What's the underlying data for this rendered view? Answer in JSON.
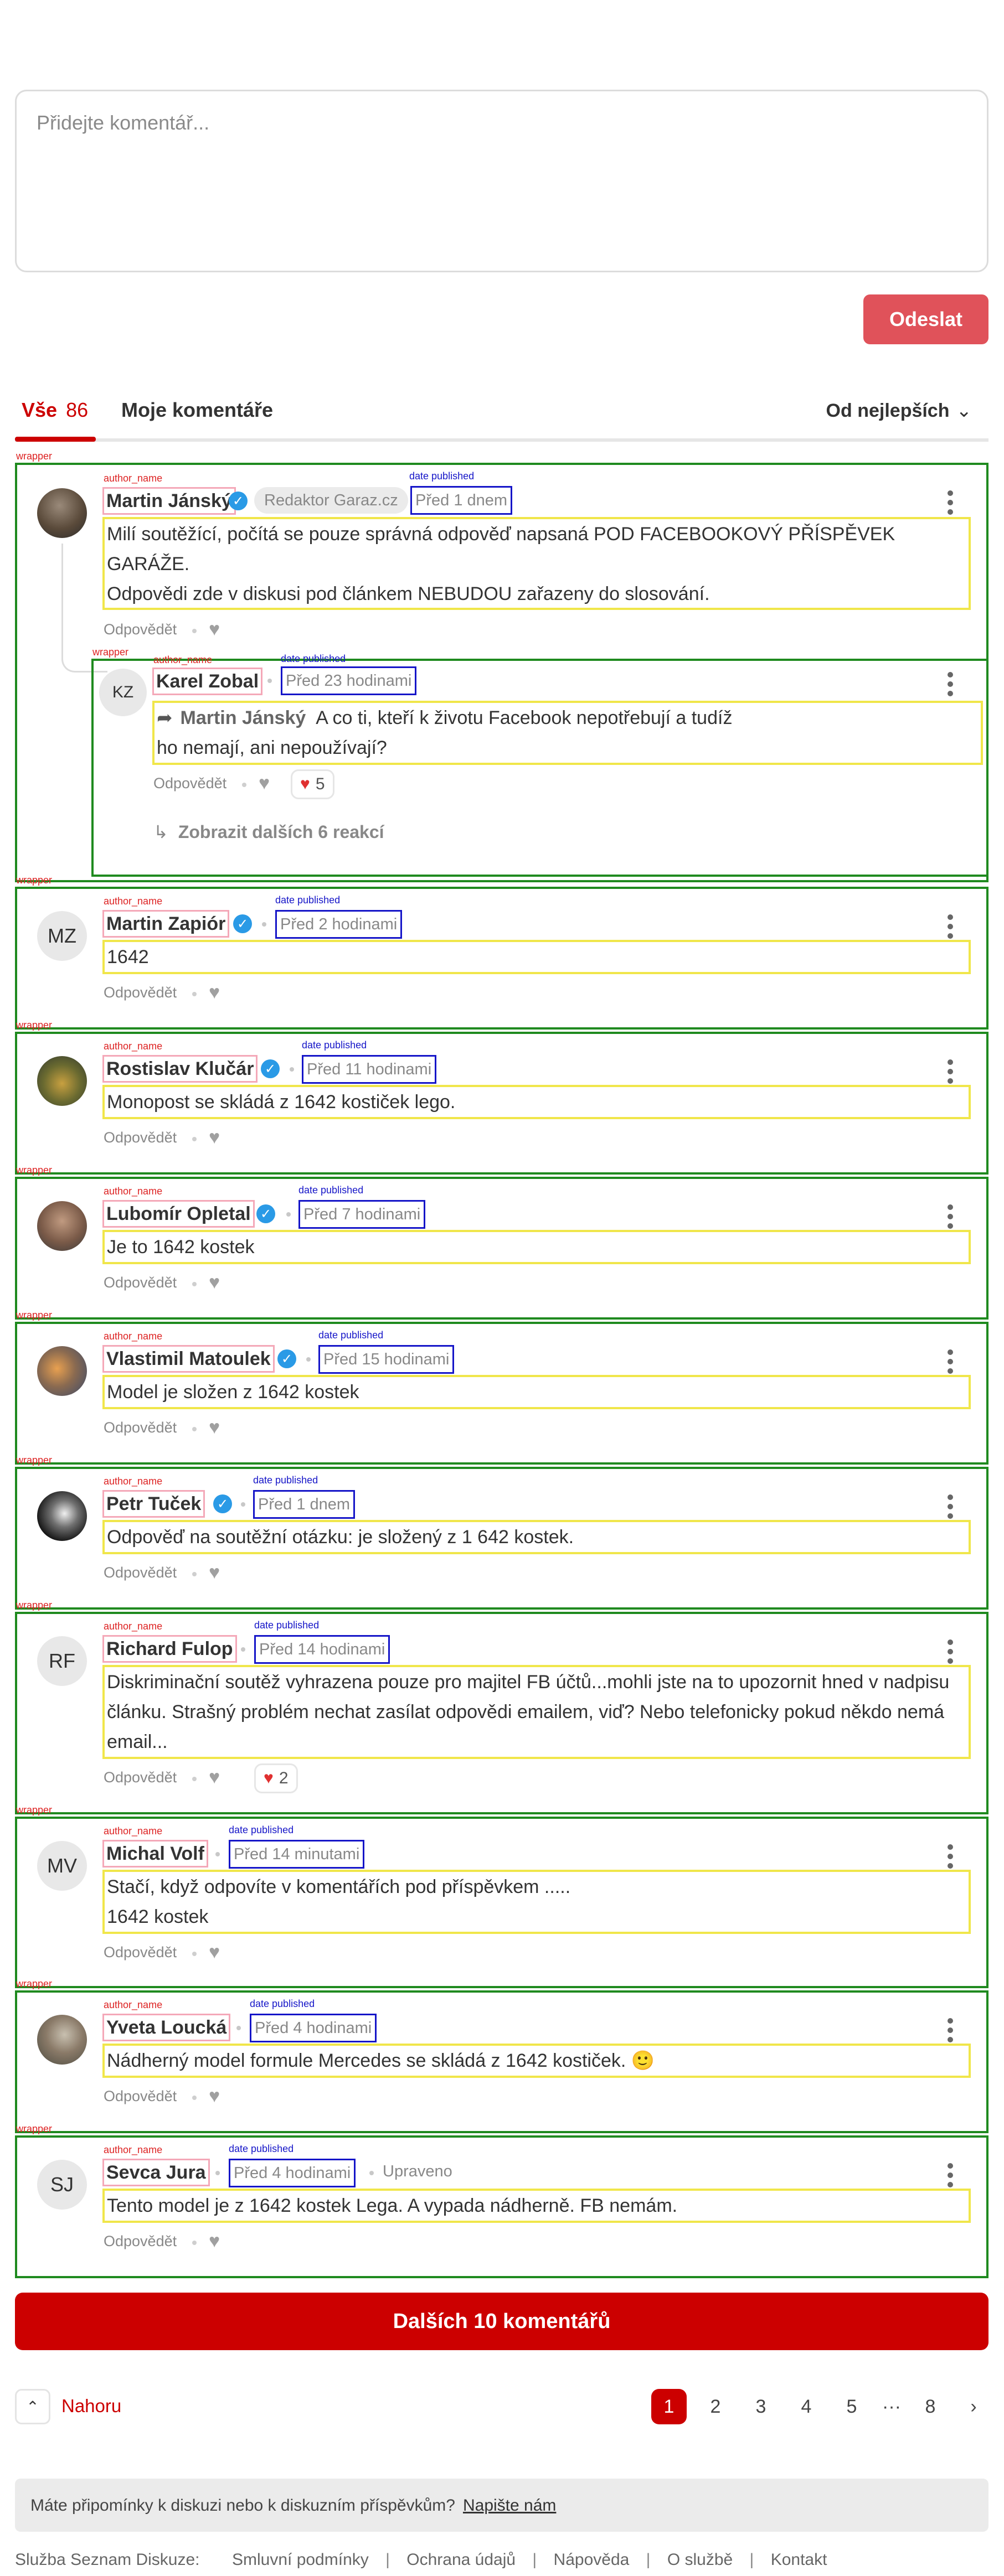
{
  "compose": {
    "placeholder": "Přidejte komentář...",
    "send_label": "Odeslat"
  },
  "tabs": {
    "all_label": "Vše",
    "all_count": "86",
    "mine_label": "Moje komentáře",
    "sort_label": "Od nejlepších"
  },
  "annotation_tags": {
    "wrapper": "wrapper",
    "author_name": "author_name",
    "date_published": "date published"
  },
  "comments": {
    "c1": {
      "author": "Martin Jánský",
      "role": "Redaktor Garaz.cz",
      "date": "Před 1 dnem",
      "lines": [
        "Milí soutěžící, počítá se pouze správná odpověď napsaná POD FACEBOOKOVÝ PŘÍSPĚVEK",
        "GARÁŽE.",
        "Odpovědi zde v diskusi pod článkem NEBUDOU zařazeny do slosování."
      ]
    },
    "c1r": {
      "initials": "KZ",
      "author": "Karel Zobal",
      "date": "Před 23 hodinami",
      "quote_name": "Martin Jánský",
      "lines": [
        "A co ti, kteří k životu Facebook nepotřebují a tudíž",
        "ho nemají, ani nepoužívají?"
      ],
      "likes": "5",
      "more_replies": "Zobrazit dalších 6 reakcí"
    },
    "c2": {
      "initials": "MZ",
      "author": "Martin Zapiór",
      "date": "Před 2 hodinami",
      "lines": [
        "1642"
      ]
    },
    "c3": {
      "author": "Rostislav Klučár",
      "date": "Před 11 hodinami",
      "lines": [
        "Monopost se skládá z 1642 kostiček lego."
      ]
    },
    "c4": {
      "author": "Lubomír Opletal",
      "date": "Před 7 hodinami",
      "lines": [
        "Je to 1642 kostek"
      ]
    },
    "c5": {
      "author": "Vlastimil Matoulek",
      "date": "Před 15 hodinami",
      "lines": [
        "Model je složen z 1642 kostek"
      ]
    },
    "c6": {
      "author": "Petr Tuček",
      "date": "Před 1 dnem",
      "lines": [
        "Odpověď na soutěžní otázku: je složený z 1 642 kostek."
      ]
    },
    "c7": {
      "initials": "RF",
      "author": "Richard Fulop",
      "date": "Před 14 hodinami",
      "lines": [
        "Diskriminační soutěž vyhrazena pouze pro majitel FB účtů...mohli jste na to upozornit hned v nadpisu",
        "článku. Strašný problém nechat zasílat odpovědi emailem, viď? Nebo telefonicky pokud někdo nemá",
        "email..."
      ],
      "likes": "2"
    },
    "c8": {
      "initials": "MV",
      "author": "Michal Volf",
      "date": "Před 14 minutami",
      "lines": [
        "Stačí, když odpovíte v komentářích pod příspěvkem .....",
        "1642 kostek"
      ]
    },
    "c9": {
      "author": "Yveta Loucká",
      "date": "Před 4 hodinami",
      "lines": [
        "Nádherný model formule Mercedes se skládá z 1642 kostiček. 🙂"
      ]
    },
    "c10": {
      "initials": "SJ",
      "author": "Sevca Jura",
      "date": "Před 4 hodinami",
      "edited": "Upraveno",
      "lines": [
        "Tento model je z 1642 kostek Lega. A vypada nádherně. FB nemám."
      ]
    }
  },
  "reply_label": "Odpovědět",
  "load_more_label": "Dalších 10 komentářů",
  "back_to_top_label": "Nahoru",
  "pagination": {
    "pages": [
      "1",
      "2",
      "3",
      "4",
      "5",
      "···",
      "8"
    ],
    "current": "1"
  },
  "feedback": {
    "text": "Máte připomínky k diskuzi nebo k diskuzním příspěvkům?",
    "link": "Napište nám"
  },
  "footer": {
    "service": "Služba Seznam Diskuze:",
    "links": [
      "Smluvní podmínky",
      "Ochrana údajů",
      "Nápověda",
      "O službě",
      "Kontakt"
    ]
  },
  "colors": {
    "accent": "#cc0000",
    "send_button": "#e0525a",
    "verified": "#2a9ae6",
    "wrapper_outline": "#1f8a1f",
    "text_outline": "#f0e64a",
    "date_outline": "#1515c8",
    "author_outline": "#f4a8b8"
  }
}
